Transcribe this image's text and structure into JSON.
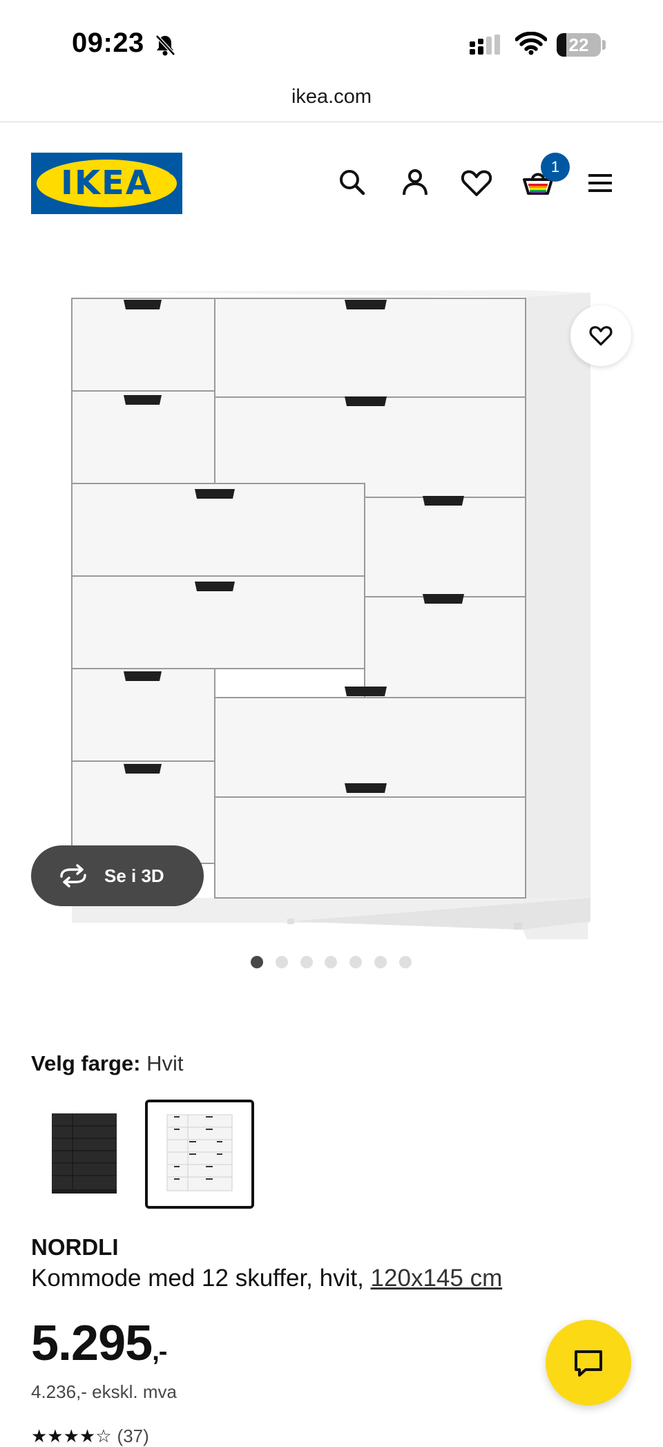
{
  "status_bar": {
    "time": "09:23",
    "battery_level": "22"
  },
  "browser": {
    "url": "ikea.com"
  },
  "header": {
    "logo_text": "IKEA",
    "logo_mark": "®",
    "cart_count": "1",
    "icons": [
      "search-icon",
      "account-icon",
      "heart-icon",
      "cart-icon",
      "menu-icon"
    ]
  },
  "gallery": {
    "view_3d_label": "Se i 3D",
    "image_count": 7,
    "active_index": 0
  },
  "color_selector": {
    "label": "Velg farge:",
    "selected": "Hvit",
    "options": [
      {
        "name": "Antrasitt",
        "color": "#2f2f2f",
        "selected": false
      },
      {
        "name": "Hvit",
        "color": "#ffffff",
        "selected": true
      }
    ]
  },
  "product": {
    "name": "NORDLI",
    "description": "Kommode med 12 skuffer, hvit, ",
    "size_link": "120x145 cm",
    "price_main": "5.295",
    "price_suffix": ",-",
    "price_ex_vat": "4.236,- ekskl. mva",
    "rating_stars": "★★★★☆",
    "rating_count": "(37)"
  },
  "colors": {
    "ikea_blue": "#0058a3",
    "ikea_yellow": "#ffdb00",
    "chat_yellow": "#fbd914",
    "dark_grey": "#484848"
  }
}
